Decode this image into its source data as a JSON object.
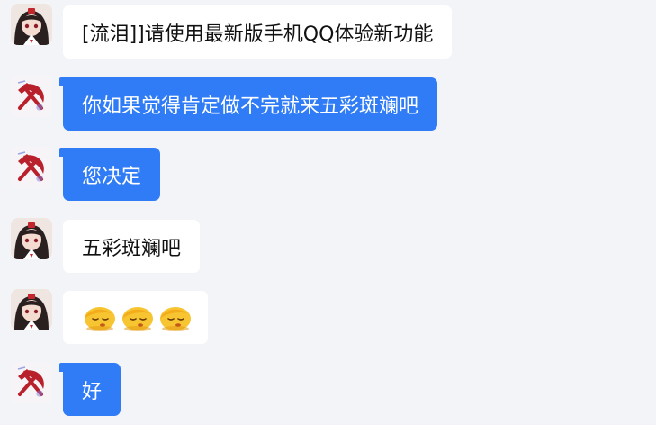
{
  "messages": [
    {
      "sender": "girl",
      "style": "white",
      "text": "[流泪]]请使用最新版手机QQ体验新功能"
    },
    {
      "sender": "sickle",
      "style": "blue",
      "text": "你如果觉得肯定做不完就来五彩斑斓吧"
    },
    {
      "sender": "sickle",
      "style": "blue",
      "text": "您决定"
    },
    {
      "sender": "girl",
      "style": "white",
      "text": "五彩斑斓吧"
    },
    {
      "sender": "girl",
      "style": "white",
      "emoji": [
        "sleepy-face-emoji",
        "sleepy-face-emoji",
        "sleepy-face-emoji"
      ]
    },
    {
      "sender": "sickle",
      "style": "blue",
      "text": "好"
    }
  ],
  "colors": {
    "background": "#f3f4f7",
    "blue_bubble": "#2f7cf6",
    "white_bubble": "#ffffff",
    "emoji": "#f7c531",
    "sickle": "#b8202b"
  },
  "icons": {
    "girl_avatar": "anime-girl-avatar",
    "sickle_avatar": "hammer-and-sickle-icon"
  }
}
